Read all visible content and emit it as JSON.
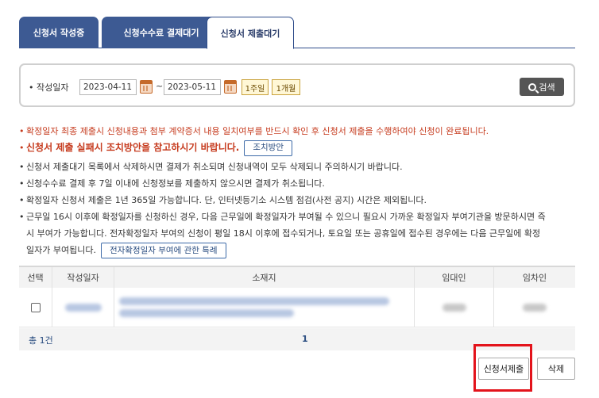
{
  "tabs": [
    {
      "label": "신청서 작성중"
    },
    {
      "label": "신청수수료 결제대기"
    },
    {
      "label": "신청서 제출대기"
    }
  ],
  "search": {
    "date_label": "작성일자",
    "start_date": "2023-04-11",
    "end_date": "2023-05-11",
    "tilde": "~",
    "week_btn": "1주일",
    "month_btn": "1개월",
    "search_btn": "검색"
  },
  "notices": {
    "n1": "확정일자 최종 제출시 신청내용과 첨부 계약증서 내용 일치여부를 반드시 확인 후 신청서 제출을 수행하여야 신청이 완료됩니다.",
    "n2": "신청서 제출 실패시 조치방안을 참고하시기 바랍니다.",
    "n2_btn": "조치방안",
    "n3": "신청서 제출대기 목록에서 삭제하시면 결제가 취소되며 신청내역이 모두 삭제되니 주의하시기 바랍니다.",
    "n4": "신청수수료 결제 후 7일 이내에 신청정보를 제출하지 않으시면 결제가 취소됩니다.",
    "n5": "확정일자 신청서 제출은 1년 365일 가능합니다. 단, 인터넷등기소 시스템 점검(사전 공지) 시간은 제외됩니다.",
    "n6_l1": "근무일 16시 이후에 확정일자를 신청하신 경우, 다음 근무일에 확정일자가 부여될 수 있으니 필요시 가까운 확정일자 부여기관을 방문하시면 즉",
    "n6_l2": "시 부여가 가능합니다. 전자확정일자 부여의 신청이 평일 18시 이후에 접수되거나, 토요일 또는 공휴일에 접수된 경우에는 다음 근무일에 확정",
    "n6_l3": "일자가 부여됩니다.",
    "n6_btn": "전자확정일자 부여에 관한 특례"
  },
  "table": {
    "headers": [
      "선택",
      "작성일자",
      "소재지",
      "임대인",
      "임차인"
    ]
  },
  "footer": {
    "total": "총 1건",
    "page": "1"
  },
  "actions": {
    "submit": "신청서제출",
    "delete": "삭제"
  },
  "colors": {
    "tab_active_bg": "#3d5a93",
    "notice_red": "#c63b1e",
    "highlight": "#e3131b"
  }
}
